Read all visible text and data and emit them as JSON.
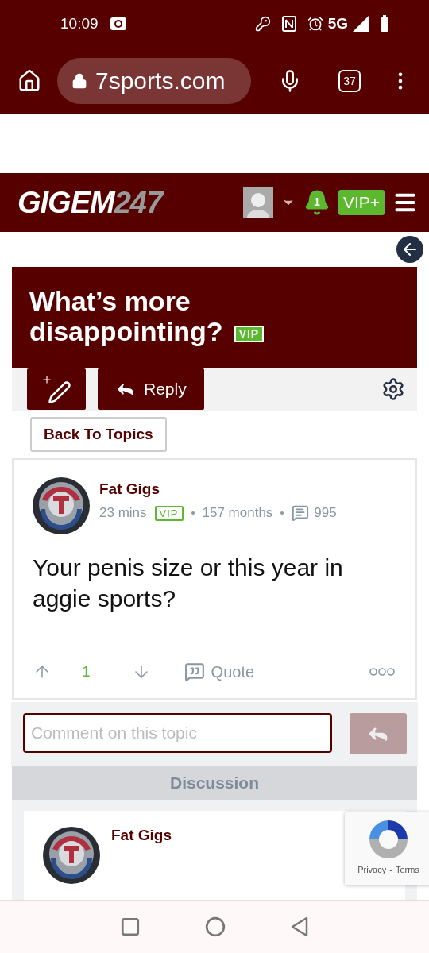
{
  "status_bar": {
    "time": "10:09",
    "network": "5G"
  },
  "browser": {
    "url": "7sports.com",
    "tab_count": "37"
  },
  "site_header": {
    "logo_main": "GIGEM",
    "logo_suffix": "247",
    "notification_count": "1",
    "vip_button": "VIP+"
  },
  "topic": {
    "title": "What’s more disappointing?",
    "badge": "VIP"
  },
  "toolbar": {
    "reply_button": "Reply"
  },
  "back_button": "Back To Topics",
  "post": {
    "author": "Fat Gigs",
    "time": "23 mins",
    "badge": "VIP",
    "tenure": "157 months",
    "post_count": "995",
    "body": "Your penis size or this year in aggie sports?",
    "votes": "1",
    "quote_button": "Quote"
  },
  "comment": {
    "placeholder": "Comment on this topic"
  },
  "discussion": {
    "heading": "Discussion",
    "posts": [
      {
        "author": "Fat Gigs"
      }
    ]
  },
  "recaptcha": {
    "privacy": "Privacy",
    "separator": "-",
    "terms": "Terms"
  }
}
